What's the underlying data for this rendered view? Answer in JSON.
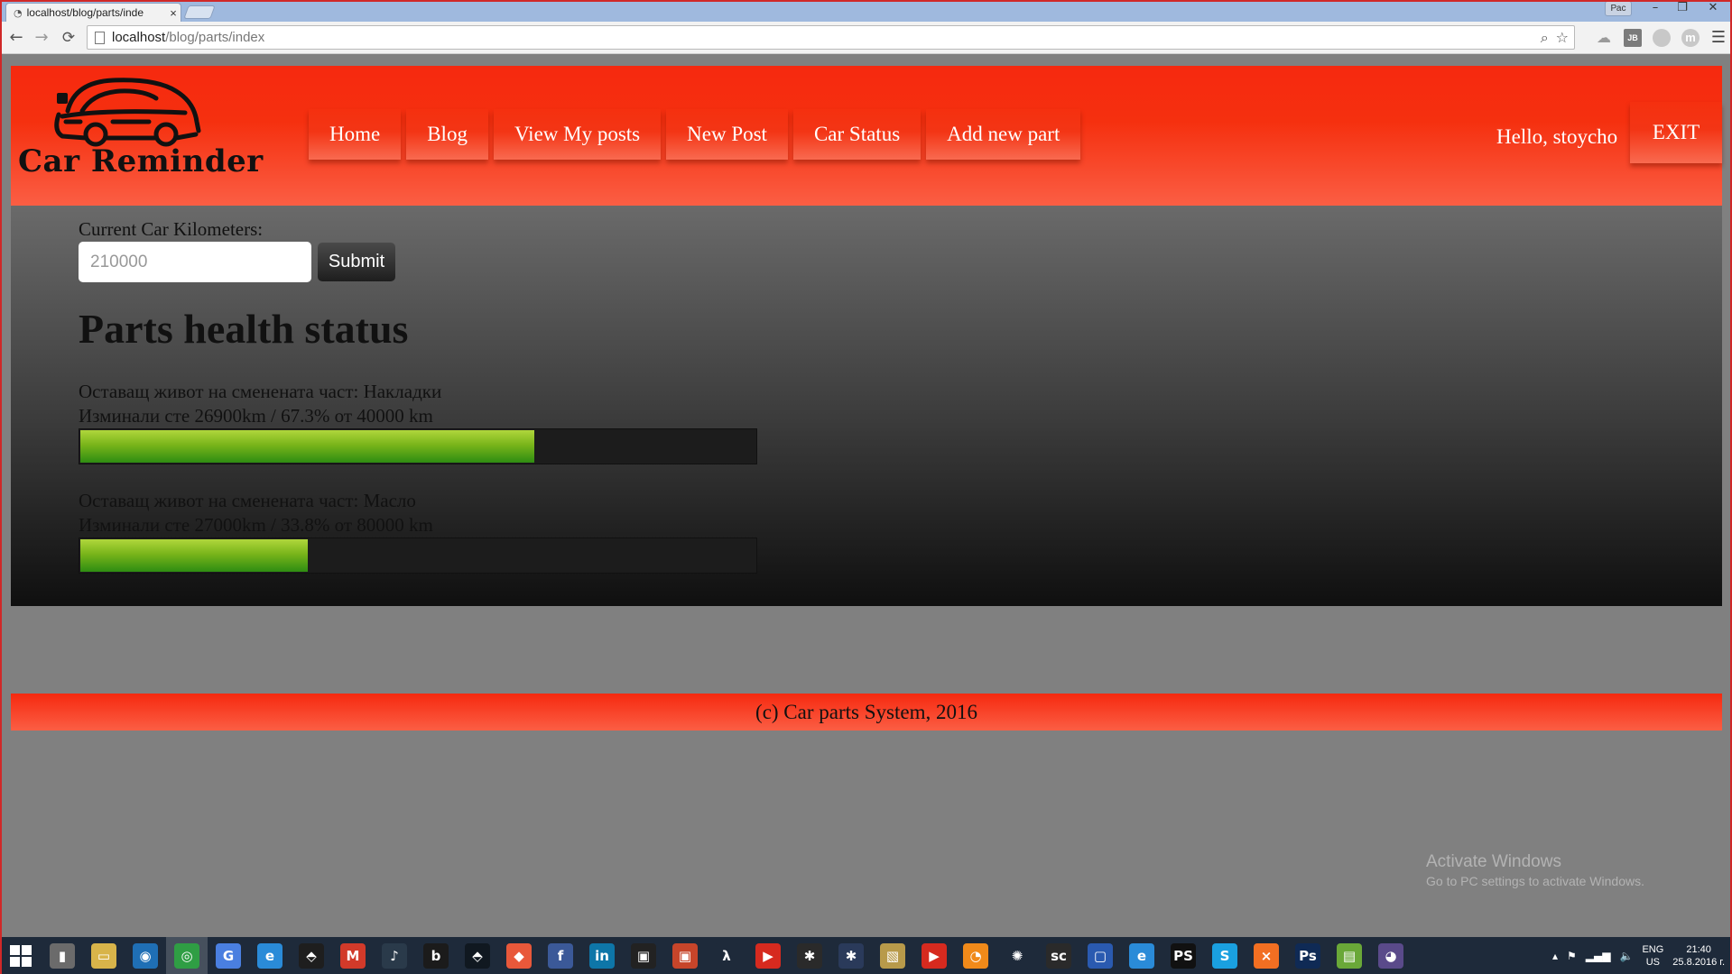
{
  "browser": {
    "tab_title": "localhost/blog/parts/inde",
    "tab_close": "×",
    "profile_badge": "Рас",
    "window_controls": {
      "minimize": "–",
      "maximize": "❐",
      "close": "✕"
    },
    "nav": {
      "back": "←",
      "forward": "→",
      "reload": "⟳"
    },
    "url_host": "localhost",
    "url_path": "/blog/parts/index",
    "omnibox_icons": [
      "zoom-icon",
      "star-icon"
    ],
    "extensions": [
      "cloud-extension-icon",
      "jb-extension-icon",
      "gray-circle-extension-icon",
      "m-extension-icon"
    ],
    "extension_labels": {
      "jb": "JB",
      "m": "m"
    },
    "menu_icon": "☰"
  },
  "header": {
    "logo_text": "Car Reminder",
    "nav_items": [
      {
        "label": "Home"
      },
      {
        "label": "Blog"
      },
      {
        "label": "View My posts"
      },
      {
        "label": "New Post"
      },
      {
        "label": "Car Status"
      },
      {
        "label": "Add new part"
      }
    ],
    "greeting": "Hello, stoycho",
    "exit_label": "EXIT"
  },
  "km_form": {
    "label": "Current Car Kilometers:",
    "placeholder": "210000",
    "value": "",
    "submit_label": "Submit"
  },
  "parts_section": {
    "title": "Parts health status",
    "parts": [
      {
        "line1": "Оставащ живот на сменената част: Накладки",
        "line2": "Изминали сте 26900km / 67.3% от 40000 km",
        "percent": 67.3
      },
      {
        "line1": "Оставащ живот на сменената част: Масло",
        "line2": "Изминали сте 27000km / 33.8% от 80000 km",
        "percent": 33.8
      }
    ]
  },
  "footer": {
    "text": "(c) Car parts System, 2016"
  },
  "watermark": {
    "title": "Activate Windows",
    "subtitle": "Go to PC settings to activate Windows."
  },
  "taskbar": {
    "apps": [
      {
        "name": "file-manager-icon",
        "glyph": "▮",
        "color": "#6b6b6b"
      },
      {
        "name": "folder-icon",
        "glyph": "▭",
        "color": "#d8b44a"
      },
      {
        "name": "firefox-icon",
        "glyph": "◉",
        "color": "#1f6fb5"
      },
      {
        "name": "chrome-icon",
        "glyph": "◎",
        "color": "#2f9e44",
        "active": true
      },
      {
        "name": "google-icon",
        "glyph": "G",
        "color": "#4a7fe0"
      },
      {
        "name": "internet-explorer-icon",
        "glyph": "e",
        "color": "#2a8bd8"
      },
      {
        "name": "app-dark-icon",
        "glyph": "⬘",
        "color": "#1e1e1e"
      },
      {
        "name": "gmail-icon",
        "glyph": "M",
        "color": "#d23a2a"
      },
      {
        "name": "music-icon",
        "glyph": "♪",
        "color": "#2a3a4a"
      },
      {
        "name": "bitdefender-icon",
        "glyph": "b",
        "color": "#1b1b1b"
      },
      {
        "name": "app-nav-icon",
        "glyph": "⬘",
        "color": "#101820"
      },
      {
        "name": "app-orange-icon",
        "glyph": "◆",
        "color": "#e8583a"
      },
      {
        "name": "facebook-icon",
        "glyph": "f",
        "color": "#3b5998"
      },
      {
        "name": "linkedin-icon",
        "glyph": "in",
        "color": "#0e76a8"
      },
      {
        "name": "app-framed-icon",
        "glyph": "▣",
        "color": "#222222"
      },
      {
        "name": "app-red-icon",
        "glyph": "▣",
        "color": "#c7452a"
      },
      {
        "name": "lambda-icon",
        "glyph": "λ",
        "color": "#1e2a3a"
      },
      {
        "name": "youtube-icon",
        "glyph": "▶",
        "color": "#d62a1f"
      },
      {
        "name": "app-runner-icon",
        "glyph": "✱",
        "color": "#2a2a2a"
      },
      {
        "name": "app-runner2-icon",
        "glyph": "✱",
        "color": "#2a3a5a"
      },
      {
        "name": "app-photo-icon",
        "glyph": "▧",
        "color": "#b89a4a"
      },
      {
        "name": "youtube2-icon",
        "glyph": "▶",
        "color": "#d62a1f"
      },
      {
        "name": "app-orange2-icon",
        "glyph": "◔",
        "color": "#f08a1a"
      },
      {
        "name": "app-fan-icon",
        "glyph": "✺",
        "color": "#1e2a3a"
      },
      {
        "name": "app-sc-icon",
        "glyph": "sc",
        "color": "#2a2a2a"
      },
      {
        "name": "app-screen-icon",
        "glyph": "▢",
        "color": "#2a5ab0"
      },
      {
        "name": "internet-explorer2-icon",
        "glyph": "e",
        "color": "#2a8bd8"
      },
      {
        "name": "phpstorm-icon",
        "glyph": "PS",
        "color": "#111111"
      },
      {
        "name": "skype-icon",
        "glyph": "S",
        "color": "#1aa0e0"
      },
      {
        "name": "xampp-icon",
        "glyph": "⨯",
        "color": "#f26f22"
      },
      {
        "name": "photoshop-icon",
        "glyph": "Ps",
        "color": "#0f2a55"
      },
      {
        "name": "app-green-icon",
        "glyph": "▤",
        "color": "#6aa838"
      },
      {
        "name": "app-purple-icon",
        "glyph": "◕",
        "color": "#5a4a8a"
      }
    ],
    "tray": {
      "up_arrow": "▴",
      "flag": "⚑",
      "signal": "▂▄▆",
      "volume": "🔈",
      "lang_top": "ENG",
      "lang_bottom": "US",
      "time": "21:40",
      "date": "25.8.2016 г."
    }
  },
  "colors": {
    "header_red": "#f6290f",
    "progress_green": "#5aa81e",
    "content_dark": "#0f0f0f",
    "page_gray": "#808080"
  }
}
